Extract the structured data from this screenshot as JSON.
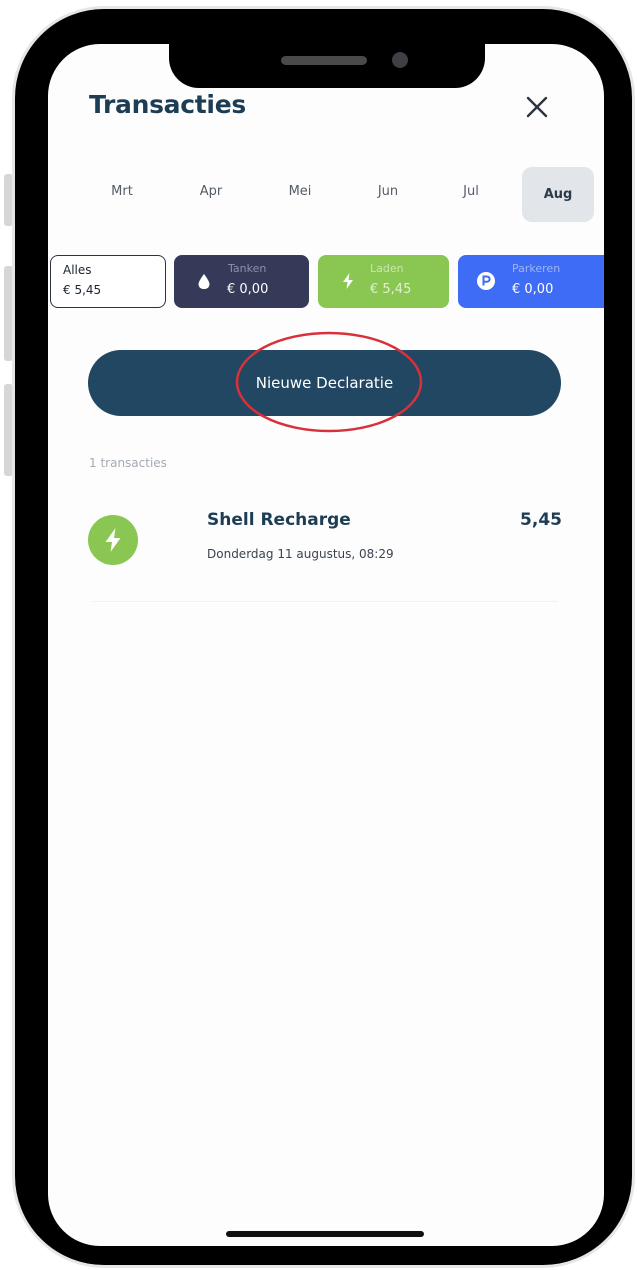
{
  "header": {
    "title": "Transacties"
  },
  "months": [
    {
      "label": "Mrt",
      "selected": false
    },
    {
      "label": "Apr",
      "selected": false
    },
    {
      "label": "Mei",
      "selected": false
    },
    {
      "label": "Jun",
      "selected": false
    },
    {
      "label": "Jul",
      "selected": false
    },
    {
      "label": "Aug",
      "selected": true
    }
  ],
  "filters": [
    {
      "label": "Alles",
      "value": "€ 5,45",
      "color": "#ffffff"
    },
    {
      "label": "Tanken",
      "value": "€ 0,00",
      "icon": "drop-icon",
      "color": "#343a58"
    },
    {
      "label": "Laden",
      "value": "€ 5,45",
      "icon": "bolt-icon",
      "color": "#8ac752"
    },
    {
      "label": "Parkeren",
      "value": "€ 0,00",
      "icon": "parking-icon",
      "color": "#3e6cf4"
    }
  ],
  "cta": {
    "label": "Nieuwe Declaratie",
    "color": "#214762",
    "highlight_color": "#d8313c"
  },
  "transactions": {
    "count_label": "1 transacties",
    "items": [
      {
        "title": "Shell Recharge",
        "amount": "5,45",
        "date": "Donderdag 11 augustus, 08:29",
        "icon": "bolt-icon"
      }
    ]
  }
}
